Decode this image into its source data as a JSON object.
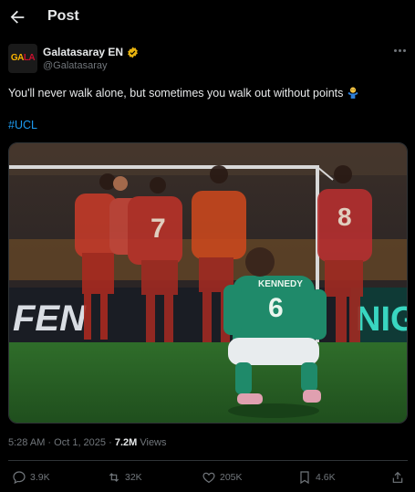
{
  "header": {
    "title": "Post"
  },
  "author": {
    "display_name": "Galatasaray EN",
    "handle": "@Galatasaray",
    "avatar_text": "GALA"
  },
  "tweet": {
    "text": "You'll never walk alone, but sometimes you walk out without points",
    "hashtag": "#UCL"
  },
  "media": {
    "jersey_number_left": "7",
    "jersey_number_right": "8",
    "player_number": "6",
    "player_name": "KENNEDY",
    "ad_board_left": "FEN",
    "ad_board_right": "NIG"
  },
  "meta": {
    "time": "5:28 AM",
    "separator": "·",
    "date": "Oct 1, 2025",
    "views_count": "7.2M",
    "views_label": "Views"
  },
  "actions": {
    "replies": "3.9K",
    "reposts": "32K",
    "likes": "205K",
    "bookmarks": "4.6K"
  },
  "colors": {
    "accent": "#1d9bf0",
    "background": "#000000",
    "text": "#e7e9ea",
    "muted": "#71767b"
  }
}
